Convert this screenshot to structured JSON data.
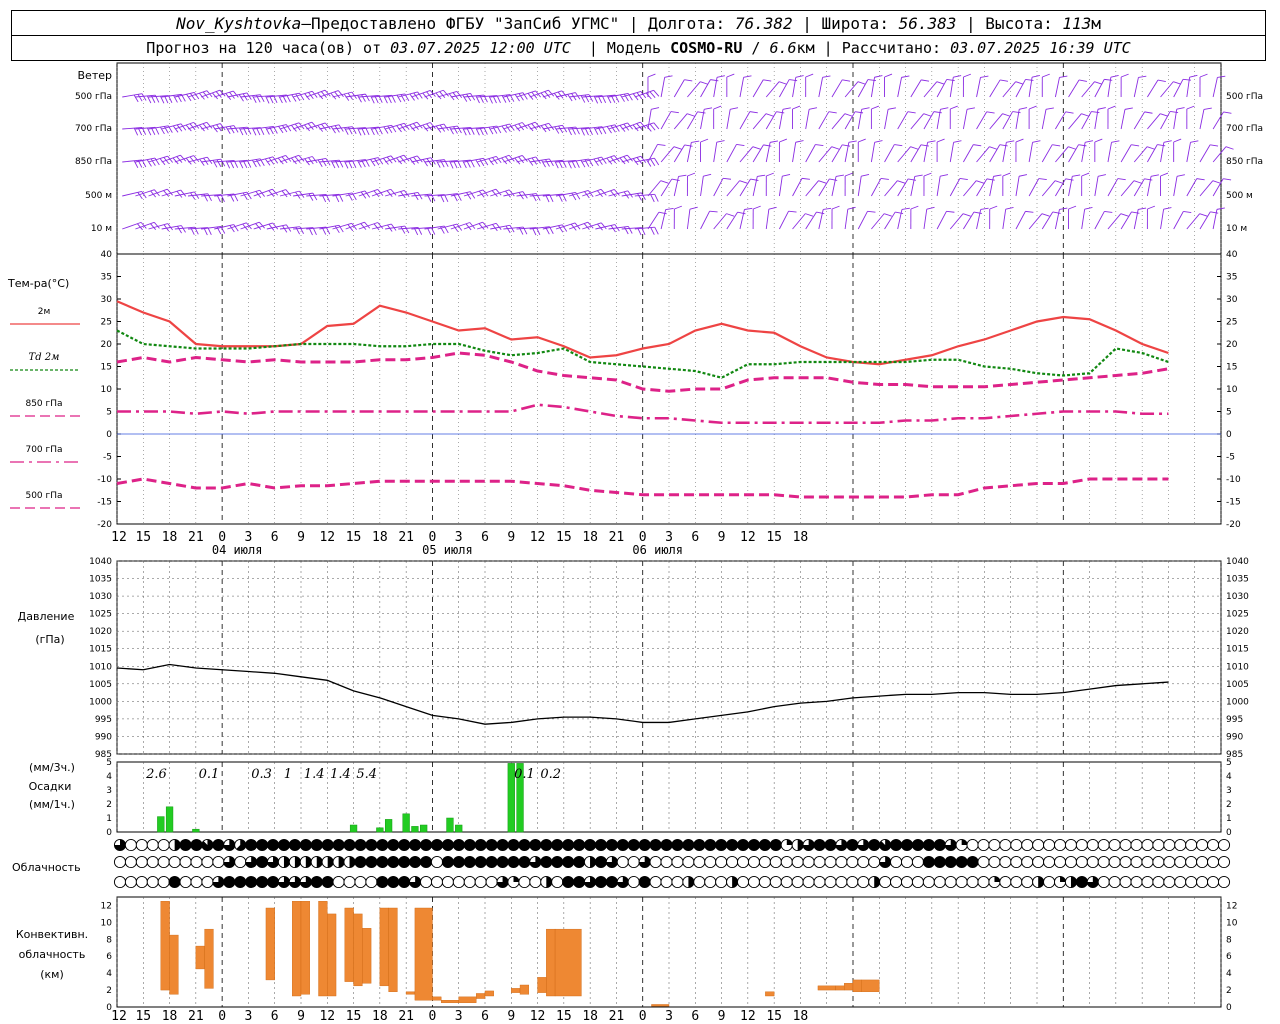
{
  "header": {
    "station": "Nov_Kyshtovka",
    "sep1": " — ",
    "provider": "Предоставлено ФГБУ \"ЗапСиб УГМС\"",
    "lon_label": "Долгота:",
    "lon": "76.382",
    "lat_label": "Широта:",
    "lat": "56.383",
    "alt_label": "Высота:",
    "alt": "113",
    "alt_unit": "м",
    "forecast_label": "Прогноз на 120 часа(ов) от",
    "forecast_date": "03.07.2025 12:00 UTC",
    "model_label": "Модель",
    "model": "COSMO-RU",
    "res": "6.6",
    "res_unit": "км",
    "calc_label": "Рассчитано:",
    "calc_date": "03.07.2025 16:39 UTC"
  },
  "chart_data": [
    {
      "type": "wind-barbs",
      "title": "Ветер",
      "levels": [
        "500 гПа",
        "700 гПа",
        "850 гПа",
        "500 м",
        "10  м"
      ],
      "colors": {
        "barb": "#8a2be2"
      }
    },
    {
      "type": "line",
      "ylabel": "Тем-ра(°С)",
      "ylim": [
        -20,
        40
      ],
      "yticks": [
        40,
        35,
        30,
        25,
        20,
        15,
        10,
        5,
        0,
        -5,
        -10,
        -15,
        -20
      ],
      "x_hours": [
        0,
        3,
        6,
        9,
        12,
        15,
        18,
        21,
        24,
        27,
        30,
        33,
        36,
        39,
        42,
        45,
        48,
        51,
        54,
        57,
        60,
        63,
        66,
        69,
        72,
        75,
        78,
        81,
        84,
        87,
        90,
        93,
        96,
        99,
        102,
        105,
        108,
        111,
        114,
        117,
        120
      ],
      "series": [
        {
          "name": "2м",
          "style": "solid",
          "color": "#ee4444",
          "values": [
            29.5,
            27,
            25,
            20,
            19.5,
            19.5,
            19.5,
            20,
            24,
            24.5,
            28.5,
            27,
            25,
            23,
            23.5,
            21,
            21.5,
            19.5,
            17,
            17.5,
            19,
            20,
            23,
            24.5,
            23,
            22.5,
            19.5,
            17,
            16,
            15.5,
            16.5,
            17.5,
            19.5,
            21,
            23,
            25,
            26,
            25.5,
            23,
            20,
            18
          ]
        },
        {
          "name": "Td 2м",
          "style": "dotted",
          "color": "#118811",
          "values": [
            23,
            20,
            19.5,
            19,
            19,
            19,
            19.5,
            20,
            20,
            20,
            19.5,
            19.5,
            20,
            20,
            18.5,
            17.5,
            18,
            19,
            16,
            15.5,
            15,
            14.5,
            14,
            12.5,
            15.5,
            15.5,
            16,
            16,
            16,
            16,
            16,
            16.5,
            16.5,
            15,
            14.5,
            13.5,
            13,
            13.5,
            19,
            18,
            16
          ]
        },
        {
          "name": "850 гПа",
          "style": "dashed",
          "color": "#dd2288",
          "values": [
            16,
            17,
            16,
            17,
            16.5,
            16,
            16.5,
            16,
            16,
            16,
            16.5,
            16.5,
            17,
            18,
            17.5,
            16,
            14,
            13,
            12.5,
            12,
            10,
            9.5,
            10,
            10,
            12,
            12.5,
            12.5,
            12.5,
            11.5,
            11,
            11,
            10.5,
            10.5,
            10.5,
            11,
            11.5,
            12,
            12.5,
            13,
            13.5,
            14.5
          ]
        },
        {
          "name": "700 гПа",
          "style": "dashdot",
          "color": "#dd2288",
          "values": [
            5,
            5,
            5,
            4.5,
            5,
            4.5,
            5,
            5,
            5,
            5,
            5,
            5,
            5,
            5,
            5,
            5,
            6.5,
            6,
            5,
            4,
            3.5,
            3.5,
            3,
            2.5,
            2.5,
            2.5,
            2.5,
            2.5,
            2.5,
            2.5,
            3,
            3,
            3.5,
            3.5,
            4,
            4.5,
            5,
            5,
            5,
            4.5,
            4.5
          ]
        },
        {
          "name": "500 гПа",
          "style": "dashed",
          "color": "#dd2288",
          "values": [
            -11,
            -10,
            -11,
            -12,
            -12,
            -11,
            -12,
            -11.5,
            -11.5,
            -11,
            -10.5,
            -10.5,
            -10.5,
            -10.5,
            -10.5,
            -10.5,
            -11,
            -11.5,
            -12.5,
            -13,
            -13.5,
            -13.5,
            -13.5,
            -13.5,
            -13.5,
            -13.5,
            -14,
            -14,
            -14,
            -14,
            -14,
            -13.5,
            -13.5,
            -12,
            -11.5,
            -11,
            -11,
            -10,
            -10,
            -10,
            -10
          ]
        }
      ]
    },
    {
      "type": "line",
      "ylabel_1": "Давление",
      "ylabel_2": "(гПа)",
      "ylim": [
        985,
        1040
      ],
      "yticks": [
        1040,
        1035,
        1030,
        1025,
        1020,
        1015,
        1010,
        1005,
        1000,
        995,
        990,
        985
      ],
      "x_hours": [
        0,
        3,
        6,
        9,
        12,
        15,
        18,
        21,
        24,
        27,
        30,
        33,
        36,
        39,
        42,
        45,
        48,
        51,
        54,
        57,
        60,
        63,
        66,
        69,
        72,
        75,
        78,
        81,
        84,
        87,
        90,
        93,
        96,
        99,
        102,
        105,
        108,
        111,
        114,
        117,
        120
      ],
      "series": [
        {
          "name": "Давление",
          "color": "#000000",
          "values": [
            1009.5,
            1009,
            1010.5,
            1009.5,
            1009,
            1008.5,
            1008,
            1007,
            1006,
            1003,
            1001,
            998.5,
            996,
            995,
            993.5,
            994,
            995,
            995.5,
            995.5,
            995,
            994,
            994,
            995,
            996,
            997,
            998.5,
            999.5,
            1000,
            1001,
            1001.5,
            1002,
            1002,
            1002.5,
            1002.5,
            1002,
            1002,
            1002.5,
            1003.5,
            1004.5,
            1005,
            1005.5
          ]
        }
      ]
    },
    {
      "type": "bar",
      "ylabel_1": "(мм/3ч.)",
      "ylabel_2": "Осадки",
      "ylabel_3": "(мм/1ч.)",
      "ylim": [
        0,
        5
      ],
      "yticks": [
        5,
        4,
        3,
        2,
        1,
        0
      ],
      "x_hours": [
        5,
        6,
        9,
        27,
        30,
        31,
        33,
        34,
        35,
        38,
        39,
        45,
        46
      ],
      "values": [
        1.1,
        1.8,
        0.2,
        0.5,
        0.3,
        0.9,
        1.3,
        0.4,
        0.5,
        1.0,
        0.5,
        4.9,
        4.9
      ],
      "annotations": [
        {
          "hour": 4.5,
          "text": "2.6"
        },
        {
          "hour": 10.5,
          "text": "0.1"
        },
        {
          "hour": 16.5,
          "text": "0.3"
        },
        {
          "hour": 19.5,
          "text": "1"
        },
        {
          "hour": 22.5,
          "text": "1.4"
        },
        {
          "hour": 25.5,
          "text": "1.4"
        },
        {
          "hour": 28.5,
          "text": "5.4"
        },
        {
          "hour": 46.5,
          "text": "0.1"
        },
        {
          "hour": 49.5,
          "text": "0.2"
        }
      ],
      "color": "#22cc22"
    },
    {
      "type": "cloud-cover",
      "ylabel": "Облачность",
      "rows": [
        [
          6,
          0,
          0,
          0,
          0,
          4,
          8,
          8,
          7,
          8,
          6,
          5,
          8,
          8,
          8,
          8,
          8,
          8,
          8,
          8,
          8,
          8,
          8,
          8,
          8,
          8,
          8,
          8,
          8,
          8,
          8,
          8,
          8,
          8,
          8,
          8,
          8,
          8,
          8,
          8,
          8,
          8,
          8,
          8,
          8,
          8,
          8,
          8,
          8,
          8,
          8,
          8,
          8,
          8,
          8,
          8,
          8,
          8,
          8,
          8,
          8,
          2,
          4,
          6,
          8,
          8,
          6,
          8,
          6,
          8,
          7,
          8,
          8,
          8,
          8,
          8,
          6,
          2,
          0,
          0,
          0,
          0,
          0,
          0,
          0,
          0,
          0,
          0,
          0,
          0,
          0,
          0,
          0,
          0,
          0,
          0,
          0,
          0,
          0,
          0,
          0,
          0
        ],
        [
          0,
          0,
          0,
          0,
          0,
          0,
          0,
          0,
          0,
          0,
          6,
          0,
          6,
          8,
          6,
          4,
          4,
          4,
          4,
          4,
          4,
          4,
          8,
          8,
          8,
          8,
          8,
          8,
          8,
          0,
          8,
          8,
          8,
          8,
          8,
          8,
          8,
          8,
          6,
          8,
          8,
          8,
          8,
          4,
          8,
          6,
          0,
          0,
          6,
          0,
          0,
          0,
          0,
          0,
          0,
          0,
          0,
          0,
          0,
          0,
          0,
          0,
          0,
          0,
          0,
          0,
          0,
          0,
          0,
          0,
          6,
          0,
          0,
          0,
          8,
          8,
          8,
          8,
          8,
          0,
          0,
          0,
          0,
          0,
          0,
          0,
          0,
          0,
          0,
          0,
          0,
          0,
          0,
          0,
          0,
          0,
          0,
          0,
          0,
          0,
          0,
          0
        ],
        [
          0,
          0,
          0,
          0,
          0,
          8,
          0,
          0,
          0,
          6,
          8,
          8,
          8,
          8,
          8,
          6,
          6,
          6,
          8,
          8,
          0,
          0,
          0,
          0,
          8,
          8,
          8,
          6,
          0,
          0,
          0,
          0,
          0,
          0,
          0,
          6,
          2,
          0,
          0,
          4,
          0,
          8,
          8,
          6,
          8,
          8,
          6,
          0,
          8,
          0,
          0,
          0,
          4,
          0,
          0,
          0,
          4,
          0,
          0,
          0,
          0,
          0,
          0,
          0,
          0,
          0,
          0,
          0,
          0,
          4,
          0,
          0,
          0,
          0,
          0,
          0,
          0,
          0,
          0,
          0,
          2,
          0,
          0,
          0,
          4,
          0,
          2,
          4,
          8,
          6,
          0,
          0,
          0,
          0,
          0,
          0,
          0,
          0,
          0,
          0,
          0,
          0
        ]
      ]
    },
    {
      "type": "bar",
      "ylabel_1": "Конвективн.",
      "ylabel_2": "облачность",
      "ylabel_3": "(км)",
      "ylim": [
        0,
        13
      ],
      "yticks": [
        12,
        10,
        8,
        6,
        4,
        2,
        0
      ],
      "bars": [
        {
          "x0": 5,
          "x1": 6,
          "bottom": 2.0,
          "top": 12.5
        },
        {
          "x0": 6,
          "x1": 7,
          "bottom": 1.5,
          "top": 8.5
        },
        {
          "x0": 9,
          "x1": 10,
          "bottom": 4.5,
          "top": 7.2
        },
        {
          "x0": 10,
          "x1": 11,
          "bottom": 2.2,
          "top": 9.2
        },
        {
          "x0": 17,
          "x1": 18,
          "bottom": 3.2,
          "top": 11.7
        },
        {
          "x0": 20,
          "x1": 21,
          "bottom": 1.3,
          "top": 12.5
        },
        {
          "x0": 21,
          "x1": 22,
          "bottom": 1.5,
          "top": 12.5
        },
        {
          "x0": 23,
          "x1": 24,
          "bottom": 1.3,
          "top": 12.5
        },
        {
          "x0": 24,
          "x1": 25,
          "bottom": 1.3,
          "top": 11.0
        },
        {
          "x0": 26,
          "x1": 27,
          "bottom": 3.0,
          "top": 11.7
        },
        {
          "x0": 27,
          "x1": 28,
          "bottom": 2.5,
          "top": 11.0
        },
        {
          "x0": 28,
          "x1": 29,
          "bottom": 2.8,
          "top": 9.3
        },
        {
          "x0": 30,
          "x1": 31,
          "bottom": 2.5,
          "top": 11.7
        },
        {
          "x0": 31,
          "x1": 32,
          "bottom": 1.8,
          "top": 11.7
        },
        {
          "x0": 33,
          "x1": 34,
          "bottom": 1.5,
          "top": 1.8
        },
        {
          "x0": 34,
          "x1": 36,
          "bottom": 0.8,
          "top": 11.7
        },
        {
          "x0": 36,
          "x1": 37,
          "bottom": 0.8,
          "top": 1.2
        },
        {
          "x0": 37,
          "x1": 39,
          "bottom": 0.5,
          "top": 0.8
        },
        {
          "x0": 39,
          "x1": 41,
          "bottom": 0.5,
          "top": 1.2
        },
        {
          "x0": 41,
          "x1": 42,
          "bottom": 1.0,
          "top": 1.6
        },
        {
          "x0": 42,
          "x1": 43,
          "bottom": 1.3,
          "top": 1.9
        },
        {
          "x0": 45,
          "x1": 46,
          "bottom": 1.7,
          "top": 2.2
        },
        {
          "x0": 46,
          "x1": 47,
          "bottom": 1.5,
          "top": 2.6
        },
        {
          "x0": 48,
          "x1": 49,
          "bottom": 1.7,
          "top": 3.5
        },
        {
          "x0": 49,
          "x1": 50,
          "bottom": 1.3,
          "top": 9.2
        },
        {
          "x0": 50,
          "x1": 53,
          "bottom": 1.3,
          "top": 9.2
        },
        {
          "x0": 61,
          "x1": 63,
          "bottom": 0.1,
          "top": 0.3
        },
        {
          "x0": 74,
          "x1": 75,
          "bottom": 1.3,
          "top": 1.8
        },
        {
          "x0": 80,
          "x1": 82,
          "bottom": 2.0,
          "top": 2.5
        },
        {
          "x0": 82,
          "x1": 83,
          "bottom": 2.0,
          "top": 2.5
        },
        {
          "x0": 83,
          "x1": 84,
          "bottom": 2.0,
          "top": 2.8
        },
        {
          "x0": 84,
          "x1": 85,
          "bottom": 1.8,
          "top": 3.2
        },
        {
          "x0": 85,
          "x1": 87,
          "bottom": 1.8,
          "top": 3.2
        }
      ],
      "color": "#ee8833"
    }
  ],
  "axis": {
    "hour_labels": [
      "12",
      "15",
      "18",
      "21",
      "0",
      "3",
      "6",
      "9",
      "12",
      "15",
      "18",
      "21",
      "0",
      "3",
      "6",
      "9",
      "12",
      "15",
      "18",
      "21",
      "0",
      "3",
      "6",
      "9",
      "12",
      "15",
      "18"
    ],
    "date_labels": [
      {
        "hour": 24,
        "text": "04 июля"
      },
      {
        "hour": 48,
        "text": "05 июля"
      },
      {
        "hour": 72,
        "text": "06 июля"
      }
    ]
  }
}
